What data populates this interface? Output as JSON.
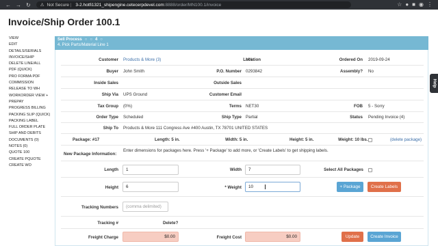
{
  "browser": {
    "not_secure": "Not Secure",
    "host": "3-2.hotfi1321_shipengine.cetecerpdevel.com",
    "path": ":8888/order/MN100.1/invoice"
  },
  "page": {
    "title": "Invoice/Ship Order 100.1"
  },
  "sidebar": {
    "items": [
      {
        "label": "VIEW"
      },
      {
        "label": "EDIT"
      },
      {
        "label": "DETAILS/SERIALS"
      },
      {
        "label": "INVOICE/SHIP"
      },
      {
        "label": "DELETE LINE/ALL"
      },
      {
        "label": "PDF (QUICK)"
      },
      {
        "label": "PRO FORMA PDF"
      },
      {
        "label": "COMMISSION"
      },
      {
        "label": "RELEASE TO WH"
      },
      {
        "label": "WORKORDER VIEW +"
      },
      {
        "label": "PREPAY"
      },
      {
        "label": "PROGRESS BILLING"
      },
      {
        "label": "PACKING SLIP (QUICK)"
      },
      {
        "label": "PACKING LABEL"
      },
      {
        "label": "FULL ORDER PLATE"
      },
      {
        "label": "SHIP AND DEBITS"
      },
      {
        "label": "DOCUMENTS (0)"
      },
      {
        "label": "NOTES (0)"
      },
      {
        "label": "QUOTE 100"
      },
      {
        "label": "CREATE PQUOTE"
      },
      {
        "label": "CREATE WO"
      }
    ]
  },
  "banner": {
    "title": "Sell Process",
    "step": "4",
    "subtitle": "4. Pick Parts/Material Line 1"
  },
  "order": {
    "customer_label": "Customer",
    "customer": "Products & More (3)",
    "location_label": "Location",
    "location": "MN",
    "ordered_on_label": "Ordered On",
    "ordered_on": "2019-09-24",
    "buyer_label": "Buyer",
    "buyer": "John Smith",
    "po_label": "P.O. Number",
    "po": "0293842",
    "assembly_label": "Assembly?",
    "assembly": "No",
    "inside_sales_label": "Inside Sales",
    "outside_sales_label": "Outside Sales",
    "ship_via_label": "Ship Via",
    "ship_via": "UPS Ground",
    "customer_email_label": "Customer Email",
    "tax_group_label": "Tax Group",
    "tax_group": "(0%)",
    "terms_label": "Terms",
    "terms": "NET30",
    "fob_label": "FOB",
    "fob": "5 - Sorry",
    "order_type_label": "Order Type",
    "order_type": "Scheduled",
    "ship_type_label": "Ship Type",
    "ship_type": "Partial",
    "status_label": "Status",
    "status": "Pending Invoice (4)",
    "ship_to_label": "Ship To",
    "ship_to": "Products & More 111 Congress Ave #400 Austin, TX 78701 UNITED STATES"
  },
  "package": {
    "number": "Package: #17",
    "length": "Length: 5 in.",
    "width": "Width: 5 in.",
    "height": "Height: 5 in.",
    "weight": "Weight: 10 lbs.",
    "delete_link": "(delete package)"
  },
  "new_package": {
    "label": "New Package Information:",
    "help": "Enter dimensions for packages here. Press '+ Package' to add more, or 'Create Labels' to get shipping labels.",
    "length_label": "Length",
    "length_value": "1",
    "width_label": "Width",
    "width_value": "7",
    "select_all_label": "Select All Packages",
    "height_label": "Height",
    "height_value": "6",
    "weight_label": "* Weight",
    "weight_value": "10",
    "add_package_button": "+ Package",
    "create_labels_button": "Create Labels"
  },
  "tracking": {
    "numbers_label": "Tracking Numbers",
    "numbers_placeholder": "(comma delimited)",
    "tracking_col": "Tracking #",
    "delete_col": "Delete?"
  },
  "charges": {
    "freight_charge_label": "Freight Charge",
    "freight_charge": "$0.00",
    "freight_cost_label": "Freight Cost",
    "freight_cost": "$0.00",
    "update_button": "Update",
    "create_invoice_button": "Create Invoice"
  },
  "help_tab": "Help",
  "colors": {
    "banner": "#76b8d3",
    "primary_button": "#5aa5d4",
    "danger_button": "#e0704a",
    "money_field": "#f7cdc2"
  }
}
